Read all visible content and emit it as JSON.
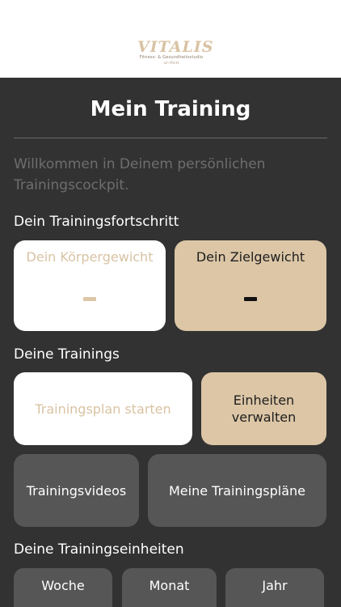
{
  "header": {
    "logo_text": "VITALIS",
    "logo_subtitle": "Fitness- & Gesundheitsstudio",
    "logo_subtitle2": "am Markt"
  },
  "page_title": "Mein Training",
  "welcome_text": "Willkommen in Deinem persönlichen Trainingscockpit.",
  "progress": {
    "heading": "Dein Trainingsfortschritt",
    "body_weight_label": "Dein Körpergewicht",
    "goal_weight_label": "Dein Zielgewicht"
  },
  "trainings": {
    "heading": "Deine Trainings",
    "start_plan_label": "Trainingsplan starten",
    "manage_units_label": "Einheiten verwalten",
    "videos_label": "Trainingsvideos",
    "my_plans_label": "Meine Trainingspläne"
  },
  "units": {
    "heading": "Deine Trainingseinheiten",
    "periods": [
      "Woche",
      "Monat",
      "Jahr"
    ]
  },
  "colors": {
    "background": "#323232",
    "accent_beige": "#dcc6a6",
    "card_grey": "#565656",
    "muted_text": "#6e6e6e"
  }
}
